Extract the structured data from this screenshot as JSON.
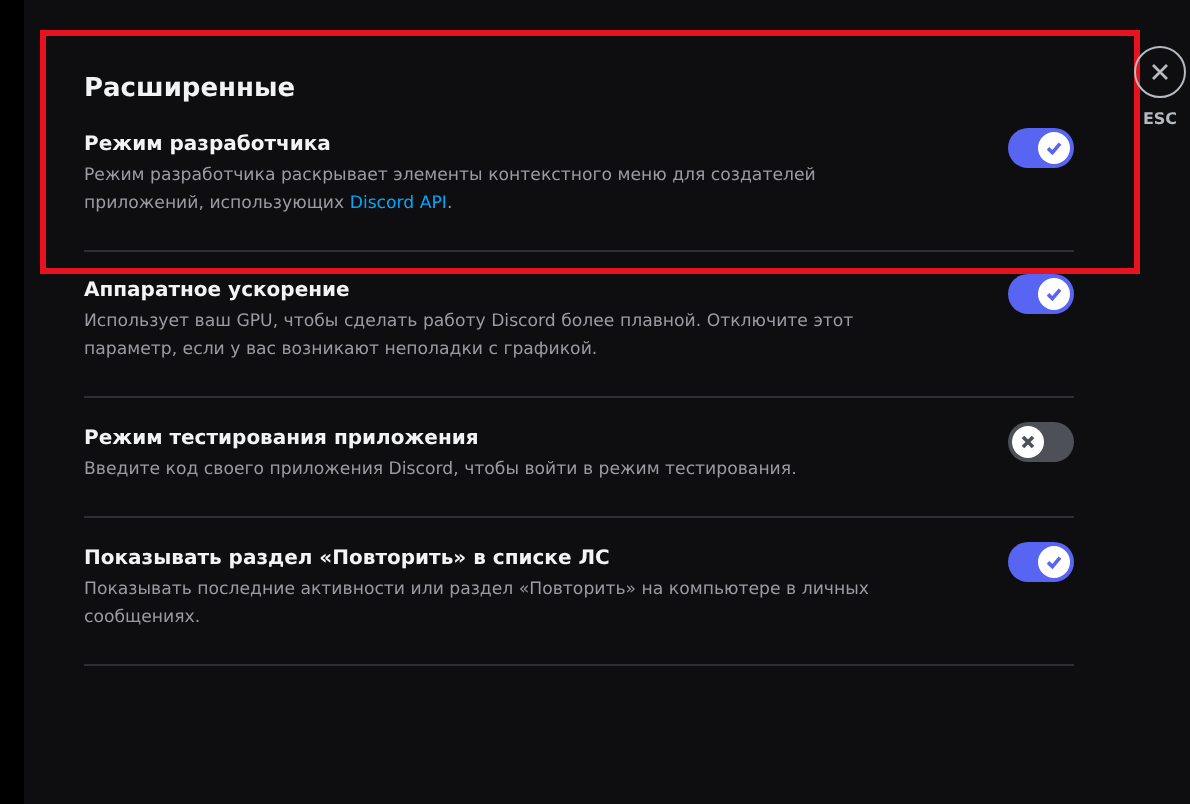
{
  "section": {
    "title": "Расширенные"
  },
  "items": [
    {
      "title": "Режим разработчика",
      "description": "Режим разработчика раскрывает элементы контекстного меню для создателей приложений, использующих ",
      "link": "Discord API",
      "description_end": ".",
      "on": true,
      "highlighted": true
    },
    {
      "title": "Аппаратное ускорение",
      "description": "Использует ваш GPU, чтобы сделать работу Discord более плавной. Отключите этот параметр, если у вас возникают неполадки с графикой.",
      "on": true,
      "highlighted": false
    },
    {
      "title": "Режим тестирования приложения",
      "description": "Введите код своего приложения Discord, чтобы войти в режим тестирования.",
      "on": false,
      "highlighted": false
    },
    {
      "title": "Показывать раздел «Повторить» в списке ЛС",
      "description": "Показывать последние активности или раздел «Повторить» на компьютере в личных сообщениях.",
      "on": true,
      "highlighted": false
    }
  ],
  "close": {
    "label": "ESC"
  }
}
